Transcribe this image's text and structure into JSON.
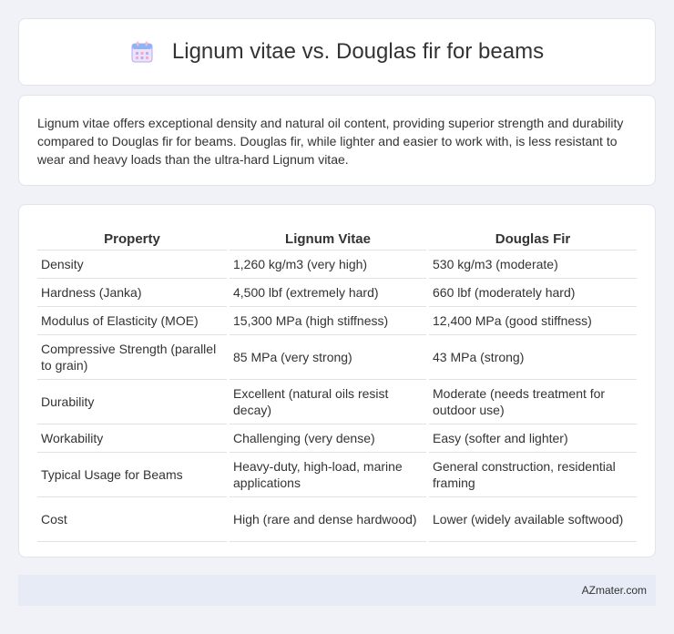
{
  "header": {
    "title": "Lignum vitae vs. Douglas fir for beams",
    "icon": "calendar-icon",
    "icon_colors": [
      "#f7b7d2",
      "#8fb3f5",
      "#b9a7f0"
    ]
  },
  "intro": {
    "text": "Lignum vitae offers exceptional density and natural oil content, providing superior strength and durability compared to Douglas fir for beams. Douglas fir, while lighter and easier to work with, is less resistant to wear and heavy loads than the ultra-hard Lignum vitae."
  },
  "table": {
    "headers": [
      "Property",
      "Lignum Vitae",
      "Douglas Fir"
    ],
    "rows": [
      [
        "Density",
        "1,260 kg/m3 (very high)",
        "530 kg/m3 (moderate)"
      ],
      [
        "Hardness (Janka)",
        "4,500 lbf (extremely hard)",
        "660 lbf (moderately hard)"
      ],
      [
        "Modulus of Elasticity (MOE)",
        "15,300 MPa (high stiffness)",
        "12,400 MPa (good stiffness)"
      ],
      [
        "Compressive Strength (parallel to grain)",
        "85 MPa (very strong)",
        "43 MPa (strong)"
      ],
      [
        "Durability",
        "Excellent (natural oils resist decay)",
        "Moderate (needs treatment for outdoor use)"
      ],
      [
        "Workability",
        "Challenging (very dense)",
        "Easy (softer and lighter)"
      ],
      [
        "Typical Usage for Beams",
        "Heavy-duty, high-load, marine applications",
        "General construction, residential framing"
      ],
      [
        "Cost",
        "High (rare and dense hardwood)",
        "Lower (widely available softwood)"
      ]
    ]
  },
  "footer": {
    "text": "AZmater.com"
  }
}
